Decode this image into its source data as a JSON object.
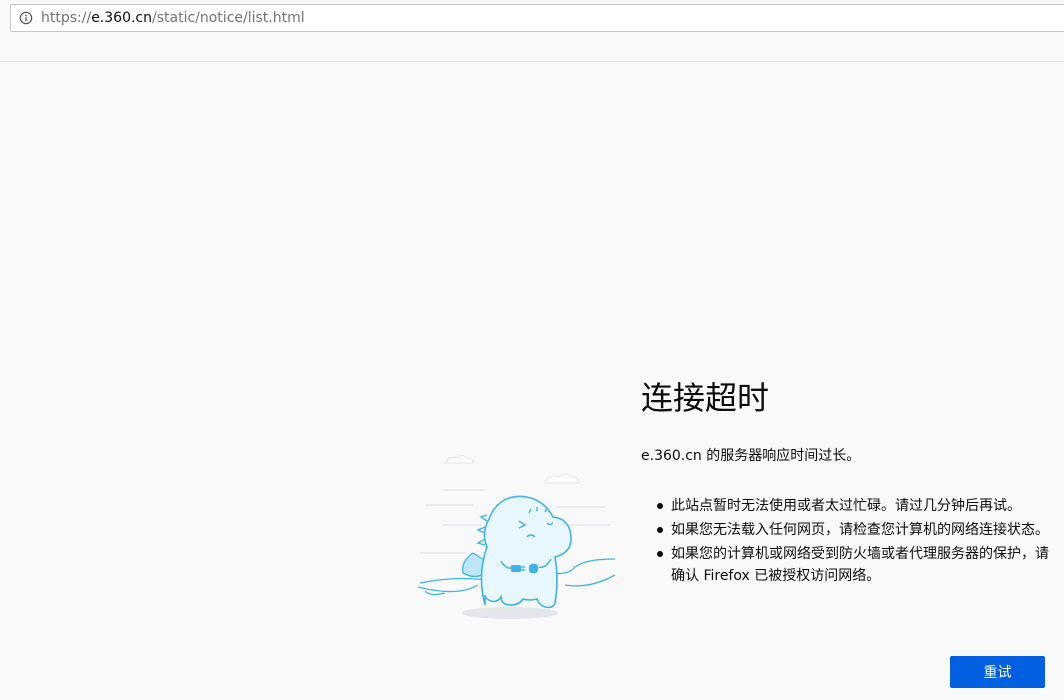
{
  "addressbar": {
    "url_scheme": "https://",
    "url_host": "e.360.cn",
    "url_path": "/static/notice/list.html"
  },
  "error": {
    "title": "连接超时",
    "description": "e.360.cn 的服务器响应时间过长。",
    "tips": [
      "此站点暂时无法使用或者太过忙碌。请过几分钟后再试。",
      "如果您无法载入任何网页，请检查您计算机的网络连接状态。",
      "如果您的计算机或网络受到防火墙或者代理服务器的保护，请确认 Firefox 已被授权访问网络。"
    ],
    "retry_label": "重试"
  },
  "colors": {
    "accent": "#0060df",
    "background": "#f9f9fa",
    "illustration_stroke": "#3eb4e8"
  },
  "icons": {
    "site_info": "info-icon",
    "illustration": "dinosaur-unplugged-illustration"
  }
}
